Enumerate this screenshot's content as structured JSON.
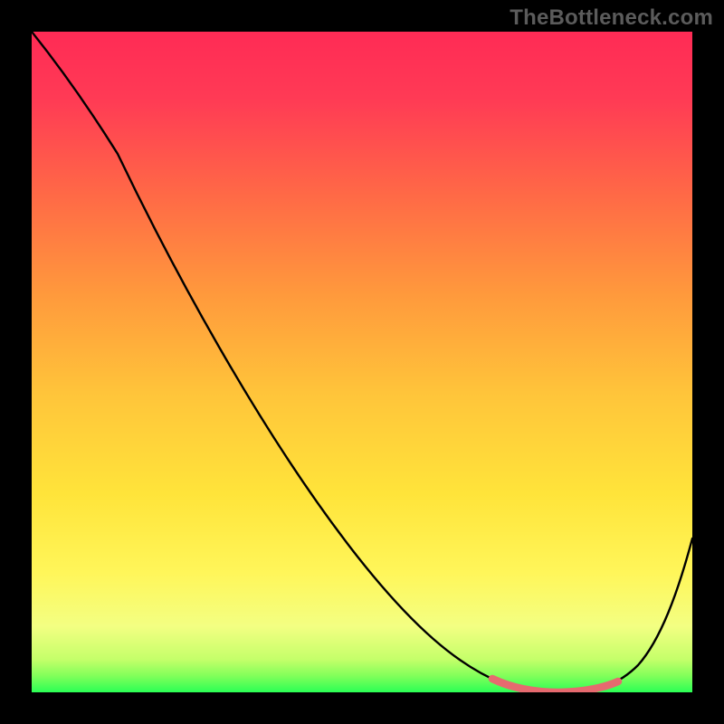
{
  "watermark": "TheBottleneck.com",
  "colors": {
    "frame": "#000000",
    "watermark": "#5b5b5b",
    "curve": "#000000",
    "optimal_marker": "#e66a6f",
    "gradient_top": "#ff2b55",
    "gradient_mid_upper": "#ff8a3a",
    "gradient_mid": "#ffd23a",
    "gradient_mid_lower": "#fff13a",
    "gradient_low": "#f6ff82",
    "gradient_bottom": "#2bff55"
  },
  "chart_data": {
    "type": "line",
    "title": "",
    "xlabel": "",
    "ylabel": "",
    "xlim": [
      0,
      100
    ],
    "ylim": [
      0,
      100
    ],
    "x": [
      0,
      5,
      10,
      15,
      20,
      25,
      30,
      35,
      40,
      45,
      50,
      55,
      60,
      65,
      70,
      75,
      80,
      85,
      90,
      95,
      100
    ],
    "values": [
      100,
      95,
      88,
      80,
      72,
      64,
      56,
      48,
      40,
      32,
      25,
      18,
      12,
      7,
      3,
      1,
      0,
      0,
      2,
      8,
      20,
      34
    ],
    "optimal_zone_x": [
      72,
      88
    ],
    "background": "vertical gradient red→orange→yellow→green representing bottleneck severity (red=high, green=low)",
    "note": "Black curve shows bottleneck percentage vs component score; pink/coral segment marks optimal range near the minimum."
  }
}
